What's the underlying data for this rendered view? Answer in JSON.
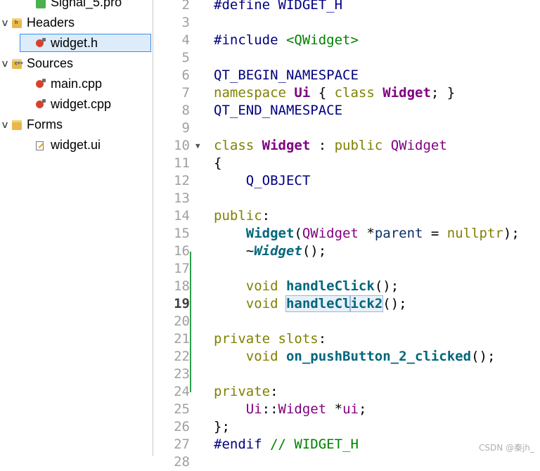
{
  "tree": {
    "items": [
      {
        "label": "Signal_5.pro",
        "level": 1,
        "icon": "pro-file-icon"
      },
      {
        "label": "Headers",
        "level": 0,
        "icon": "folder-icon",
        "expanded": true,
        "tag": "h"
      },
      {
        "label": "widget.h",
        "level": 1,
        "icon": "header-file-icon",
        "selected": true
      },
      {
        "label": "Sources",
        "level": 0,
        "icon": "folder-icon",
        "expanded": true,
        "tag": "c++"
      },
      {
        "label": "main.cpp",
        "level": 1,
        "icon": "source-file-icon"
      },
      {
        "label": "widget.cpp",
        "level": 1,
        "icon": "source-file-icon"
      },
      {
        "label": "Forms",
        "level": 0,
        "icon": "folder-icon",
        "expanded": true,
        "tag": ""
      },
      {
        "label": "widget.ui",
        "level": 1,
        "icon": "ui-file-icon"
      }
    ]
  },
  "editor": {
    "current_line": "19",
    "lines": [
      {
        "n": "2",
        "tokens": [
          {
            "t": "#define WIDGET_H",
            "c": "t-pp"
          }
        ]
      },
      {
        "n": "3",
        "tokens": []
      },
      {
        "n": "4",
        "tokens": [
          {
            "t": "#include ",
            "c": "t-pp"
          },
          {
            "t": "<QWidget>",
            "c": "t-str"
          }
        ]
      },
      {
        "n": "5",
        "tokens": []
      },
      {
        "n": "6",
        "tokens": [
          {
            "t": "QT_BEGIN_NAMESPACE",
            "c": "t-pp"
          }
        ]
      },
      {
        "n": "7",
        "tokens": [
          {
            "t": "namespace ",
            "c": "t-kw"
          },
          {
            "t": "Ui",
            "c": "t-type"
          },
          {
            "t": " { ",
            "c": "t-plain"
          },
          {
            "t": "class ",
            "c": "t-kw"
          },
          {
            "t": "Widget",
            "c": "t-type"
          },
          {
            "t": "; }",
            "c": "t-plain"
          }
        ]
      },
      {
        "n": "8",
        "tokens": [
          {
            "t": "QT_END_NAMESPACE",
            "c": "t-pp"
          }
        ]
      },
      {
        "n": "9",
        "tokens": []
      },
      {
        "n": "10",
        "fold": "▼",
        "tokens": [
          {
            "t": "class ",
            "c": "t-kw"
          },
          {
            "t": "Widget",
            "c": "t-type"
          },
          {
            "t": " : ",
            "c": "t-plain"
          },
          {
            "t": "public ",
            "c": "t-kw"
          },
          {
            "t": "QWidget",
            "c": "t-qt"
          }
        ]
      },
      {
        "n": "11",
        "tokens": [
          {
            "t": "{",
            "c": "t-plain"
          }
        ]
      },
      {
        "n": "12",
        "tokens": [
          {
            "t": "    Q_OBJECT",
            "c": "t-pp"
          }
        ]
      },
      {
        "n": "13",
        "tokens": []
      },
      {
        "n": "14",
        "tokens": [
          {
            "t": "public",
            "c": "t-kw"
          },
          {
            "t": ":",
            "c": "t-plain"
          }
        ]
      },
      {
        "n": "15",
        "tokens": [
          {
            "t": "    ",
            "c": "t-plain"
          },
          {
            "t": "Widget",
            "c": "t-fn"
          },
          {
            "t": "(",
            "c": "t-plain"
          },
          {
            "t": "QWidget",
            "c": "t-qt"
          },
          {
            "t": " *",
            "c": "t-plain"
          },
          {
            "t": "parent",
            "c": "t-param"
          },
          {
            "t": " = ",
            "c": "t-plain"
          },
          {
            "t": "nullptr",
            "c": "t-kw"
          },
          {
            "t": ");",
            "c": "t-plain"
          }
        ]
      },
      {
        "n": "16",
        "tokens": [
          {
            "t": "    ~",
            "c": "t-plain"
          },
          {
            "t": "Widget",
            "c": "t-fni"
          },
          {
            "t": "();",
            "c": "t-plain"
          }
        ]
      },
      {
        "n": "17",
        "tokens": []
      },
      {
        "n": "18",
        "tokens": [
          {
            "t": "    ",
            "c": "t-plain"
          },
          {
            "t": "void ",
            "c": "t-kw"
          },
          {
            "t": "handleClick",
            "c": "t-fn"
          },
          {
            "t": "();",
            "c": "t-plain"
          }
        ]
      },
      {
        "n": "19",
        "tokens": [
          {
            "t": "    ",
            "c": "t-plain"
          },
          {
            "t": "void ",
            "c": "t-kw"
          },
          {
            "t": "handleCl",
            "c": "t-fn t-hl",
            "cursor_after": true
          },
          {
            "t": "ick2",
            "c": "t-fn t-hl"
          },
          {
            "t": "();",
            "c": "t-plain"
          }
        ]
      },
      {
        "n": "20",
        "tokens": []
      },
      {
        "n": "21",
        "tokens": [
          {
            "t": "private ",
            "c": "t-kw"
          },
          {
            "t": "slots",
            "c": "t-kw"
          },
          {
            "t": ":",
            "c": "t-plain"
          }
        ]
      },
      {
        "n": "22",
        "tokens": [
          {
            "t": "    ",
            "c": "t-plain"
          },
          {
            "t": "void ",
            "c": "t-kw"
          },
          {
            "t": "on_pushButton_2_clicked",
            "c": "t-fn"
          },
          {
            "t": "();",
            "c": "t-plain"
          }
        ]
      },
      {
        "n": "23",
        "tokens": []
      },
      {
        "n": "24",
        "tokens": [
          {
            "t": "private",
            "c": "t-kw"
          },
          {
            "t": ":",
            "c": "t-plain"
          }
        ]
      },
      {
        "n": "25",
        "tokens": [
          {
            "t": "    ",
            "c": "t-plain"
          },
          {
            "t": "Ui",
            "c": "t-ns"
          },
          {
            "t": "::",
            "c": "t-plain"
          },
          {
            "t": "Widget",
            "c": "t-ns"
          },
          {
            "t": " *",
            "c": "t-plain"
          },
          {
            "t": "ui",
            "c": "t-ns"
          },
          {
            "t": ";",
            "c": "t-plain"
          }
        ]
      },
      {
        "n": "26",
        "tokens": [
          {
            "t": "};",
            "c": "t-plain"
          }
        ]
      },
      {
        "n": "27",
        "tokens": [
          {
            "t": "#endif ",
            "c": "t-pp"
          },
          {
            "t": "// WIDGET_H",
            "c": "t-cmt"
          }
        ]
      },
      {
        "n": "28",
        "tokens": []
      }
    ]
  },
  "watermark": "CSDN @秦jh_"
}
